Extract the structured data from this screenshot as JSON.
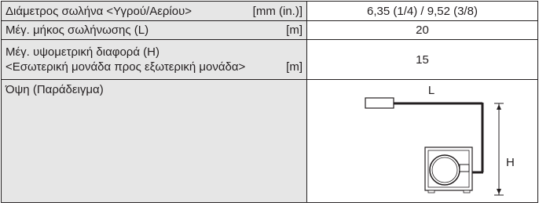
{
  "rows": {
    "diameter": {
      "label": "Διάμετρος σωλήνα <Υγρού/Αερίου>",
      "unit": "[mm (in.)]",
      "value": "6,35 (1/4) / 9,52 (3/8)"
    },
    "length": {
      "label": "Μέγ. μήκος σωλήνωσης (L)",
      "unit": "[m]",
      "value": "20"
    },
    "height": {
      "label_line1": "Μέγ. υψομετρική διαφορά (H)",
      "label_line2": "<Εσωτερική μονάδα προς εξωτερική μονάδα>",
      "unit": "[m]",
      "value": "15"
    },
    "view": {
      "label": "Όψη (Παράδειγμα)",
      "diagram": {
        "label_L": "L",
        "label_H": "H"
      }
    }
  },
  "colors": {
    "label_bg": "#e6e6e6",
    "line": "#231f20",
    "text": "#231f20"
  }
}
